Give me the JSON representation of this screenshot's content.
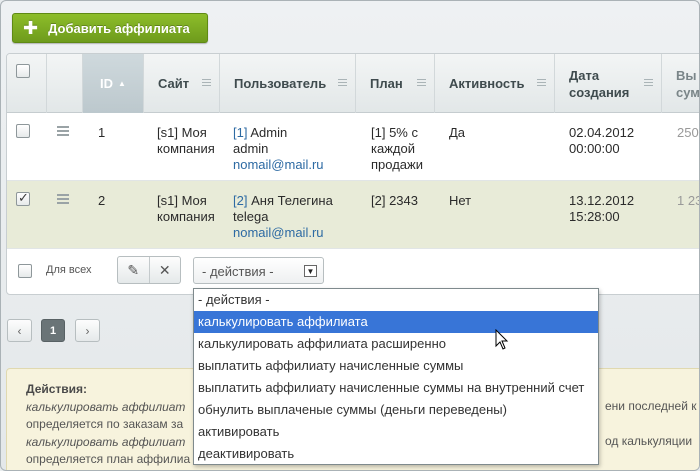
{
  "toolbar": {
    "add_label": "Добавить аффилиата"
  },
  "columns": {
    "id": "ID",
    "site": "Сайт",
    "user": "Пользователь",
    "plan": "План",
    "active": "Активность",
    "created": "Дата создания",
    "paid": "Вы сум"
  },
  "rows": [
    {
      "checked": false,
      "id": "1",
      "site": "[s1] Моя компания",
      "user_id": "[1]",
      "user_name": "Admin",
      "user_login": "admin",
      "email": "nomail@mail.ru",
      "plan": "[1] 5% с каждой продажи",
      "active": "Да",
      "created_date": "02.04.2012",
      "created_time": "00:00:00",
      "paid": "250"
    },
    {
      "checked": true,
      "id": "2",
      "site": "[s1] Моя компания",
      "user_id": "[2]",
      "user_name": "Аня Телегина",
      "user_login": "telega",
      "email": "nomail@mail.ru",
      "plan": "[2] 2343",
      "active": "Нет",
      "created_date": "13.12.2012",
      "created_time": "15:28:00",
      "paid": "1 23"
    }
  ],
  "footer": {
    "for_all": "Для всех",
    "action_placeholder": "- действия -",
    "current_page": "1"
  },
  "dropdown": {
    "options": [
      "- действия -",
      "калькулировать аффилиата",
      "калькулировать аффилиата расширенно",
      "выплатить аффилиату начисленные суммы",
      "выплатить аффилиату начисленные суммы на внутренний счет",
      "обнулить выплаченые суммы (деньги переведены)",
      "активировать",
      "деактивировать"
    ],
    "highlighted_index": 1
  },
  "notes": {
    "title": "Действия:",
    "line1": "калькулировать аффилиат",
    "line2": "определяется по заказам за",
    "line3": "калькулировать аффилиат",
    "line4": "определяется план аффилиа",
    "right1": "ени последней к",
    "right3": "од калькуляции"
  },
  "colors": {
    "accent_green": "#7aab22",
    "highlight": "#3875d7",
    "selected_row": "#e8ebd8"
  }
}
